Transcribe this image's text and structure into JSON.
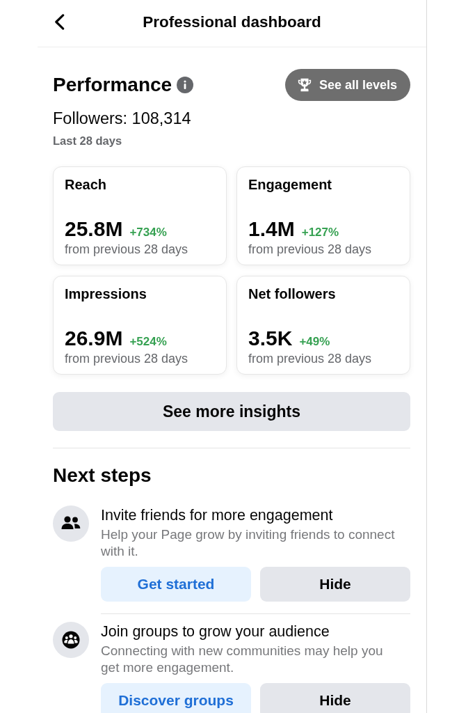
{
  "header": {
    "title": "Professional dashboard"
  },
  "performance": {
    "title": "Performance",
    "levels_button": "See all levels",
    "followers": "Followers: 108,314",
    "period": "Last 28 days",
    "metrics": [
      {
        "label": "Reach",
        "value": "25.8M",
        "change": "+734%",
        "comparison": "from previous 28 days"
      },
      {
        "label": "Engagement",
        "value": "1.4M",
        "change": "+127%",
        "comparison": "from previous 28 days"
      },
      {
        "label": "Impressions",
        "value": "26.9M",
        "change": "+524%",
        "comparison": "from previous 28 days"
      },
      {
        "label": "Net followers",
        "value": "3.5K",
        "change": "+49%",
        "comparison": "from previous 28 days"
      }
    ],
    "insights_button": "See more insights"
  },
  "next_steps": {
    "title": "Next steps",
    "items": [
      {
        "title": "Invite friends for more engagement",
        "description": "Help your Page grow by inviting friends to connect with it.",
        "primary_button": "Get started",
        "secondary_button": "Hide"
      },
      {
        "title": "Join groups to grow your audience",
        "description": "Connecting with new communities may help you get more engagement.",
        "primary_button": "Discover groups",
        "secondary_button": "Hide"
      }
    ]
  }
}
